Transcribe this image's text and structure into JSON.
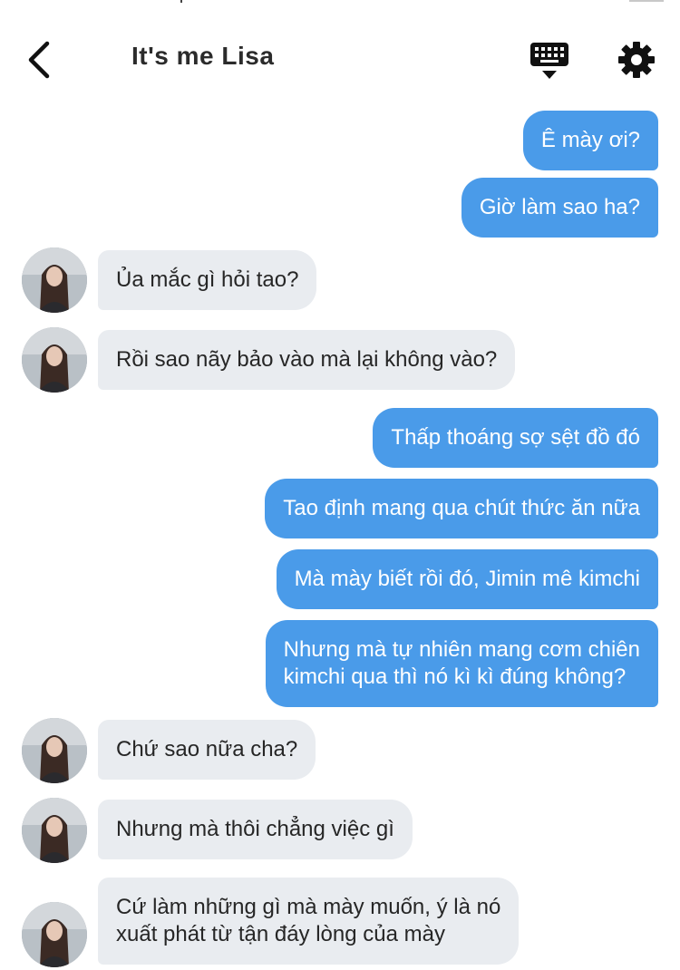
{
  "header": {
    "title": "It's me Lisa",
    "back_icon": "chevron-left-icon",
    "keyboard_icon": "keyboard-hide-icon",
    "settings_icon": "gear-icon"
  },
  "colors": {
    "outgoing_bubble": "#4a9be9",
    "incoming_bubble": "#e9ecf0",
    "icon": "#111111"
  },
  "messages": [
    {
      "sender": "me",
      "text": "Ê mày ơi?"
    },
    {
      "sender": "me",
      "text": "Giờ làm sao ha?"
    },
    {
      "sender": "Lisa",
      "text": "Ủa mắc gì hỏi tao?"
    },
    {
      "sender": "Lisa",
      "text": "Rồi sao nãy bảo vào mà lại không vào?"
    },
    {
      "sender": "me",
      "text": "Thấp thoáng sợ sệt đồ đó"
    },
    {
      "sender": "me",
      "text": "Tao định mang qua chút thức ăn nữa"
    },
    {
      "sender": "me",
      "text": "Mà mày biết rồi đó, Jimin mê kimchi"
    },
    {
      "sender": "me",
      "lines": [
        "Nhưng mà tự nhiên mang cơm chiên",
        "kimchi qua thì nó kì kì đúng không?"
      ]
    },
    {
      "sender": "Lisa",
      "text": "Chứ sao nữa cha?"
    },
    {
      "sender": "Lisa",
      "text": "Nhưng mà thôi chẳng việc gì"
    },
    {
      "sender": "Lisa",
      "lines": [
        "Cứ làm những gì mà mày muốn, ý là nó",
        "xuất phát từ tận đáy lòng của mày"
      ]
    }
  ]
}
